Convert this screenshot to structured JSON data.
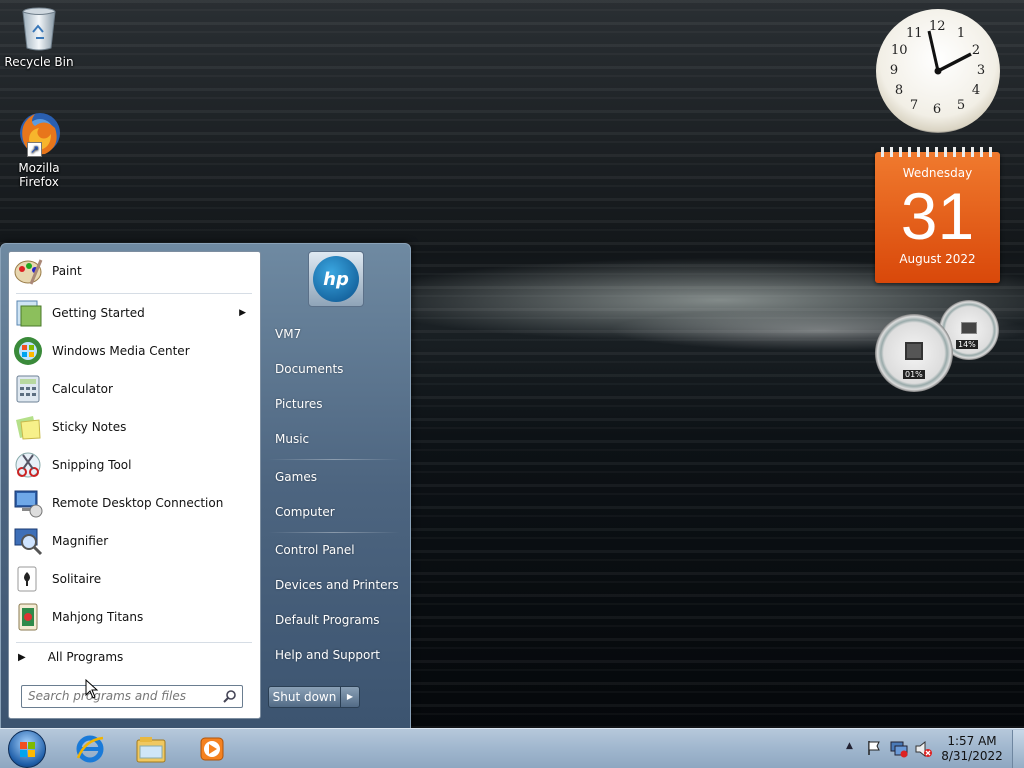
{
  "desktop": {
    "icons": [
      {
        "label": "Recycle Bin",
        "icon": "recycle-bin-icon"
      },
      {
        "label": "Mozilla Firefox",
        "label_line1": "Mozilla",
        "label_line2": "Firefox",
        "icon": "firefox-icon"
      }
    ]
  },
  "gadgets": {
    "clock": {
      "numbers": [
        "12",
        "1",
        "2",
        "3",
        "4",
        "5",
        "6",
        "7",
        "8",
        "9",
        "10",
        "11"
      ],
      "time": "1:57"
    },
    "calendar": {
      "weekday": "Wednesday",
      "day": "31",
      "month_year": "August 2022"
    },
    "cpu_meter": {
      "cpu": "01%",
      "memory": "14%"
    }
  },
  "start_menu": {
    "programs": [
      {
        "label": "Paint",
        "icon": "paint-icon"
      },
      {
        "label": "Getting Started",
        "icon": "getting-started-icon",
        "submenu": true
      },
      {
        "label": "Windows Media Center",
        "icon": "media-center-icon"
      },
      {
        "label": "Calculator",
        "icon": "calculator-icon"
      },
      {
        "label": "Sticky Notes",
        "icon": "sticky-notes-icon"
      },
      {
        "label": "Snipping Tool",
        "icon": "snipping-tool-icon"
      },
      {
        "label": "Remote Desktop Connection",
        "icon": "remote-desktop-icon"
      },
      {
        "label": "Magnifier",
        "icon": "magnifier-icon"
      },
      {
        "label": "Solitaire",
        "icon": "solitaire-icon"
      },
      {
        "label": "Mahjong Titans",
        "icon": "mahjong-icon"
      }
    ],
    "all_programs": "All Programs",
    "search_placeholder": "Search programs and files",
    "user_logo_text": "hp",
    "right_items": [
      "VM7",
      "Documents",
      "Pictures",
      "Music",
      "Games",
      "Computer",
      "Control Panel",
      "Devices and Printers",
      "Default Programs",
      "Help and Support"
    ],
    "shutdown_label": "Shut down"
  },
  "taskbar": {
    "pinned": [
      {
        "icon": "internet-explorer-icon"
      },
      {
        "icon": "windows-explorer-icon"
      },
      {
        "icon": "media-player-icon"
      }
    ],
    "clock_time": "1:57 AM",
    "clock_date": "8/31/2022"
  },
  "colors": {
    "calendar": "#e05a14",
    "taskbar": "#a8bdd3",
    "start_right_pane": "#4d6580"
  }
}
